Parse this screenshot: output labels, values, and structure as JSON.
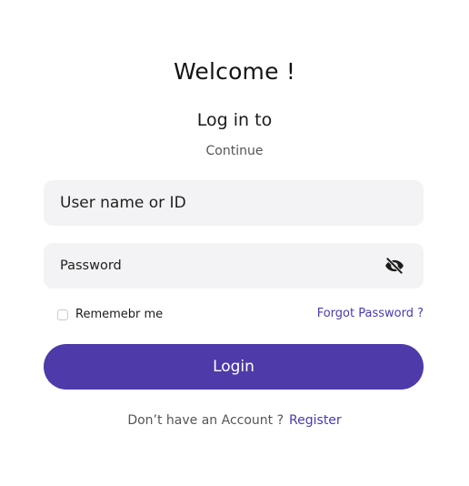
{
  "header": {
    "title": "Welcome !",
    "subtitle": "Log in to",
    "caption": "Continue"
  },
  "form": {
    "username": {
      "placeholder": "User name or ID",
      "value": ""
    },
    "password": {
      "placeholder": "Password",
      "value": "",
      "toggle_icon": "eye-slash-icon"
    },
    "remember_label": "Rememebr me",
    "remember_checked": false,
    "forgot_label": "Forgot Password ?",
    "submit_label": "Login"
  },
  "footer": {
    "prompt": "Don’t have an Account ?",
    "register_label": "Register"
  },
  "colors": {
    "accent": "#4e3aa8",
    "link": "#4b3ab0",
    "field_bg": "#f3f3f5",
    "muted_text": "#555555"
  }
}
